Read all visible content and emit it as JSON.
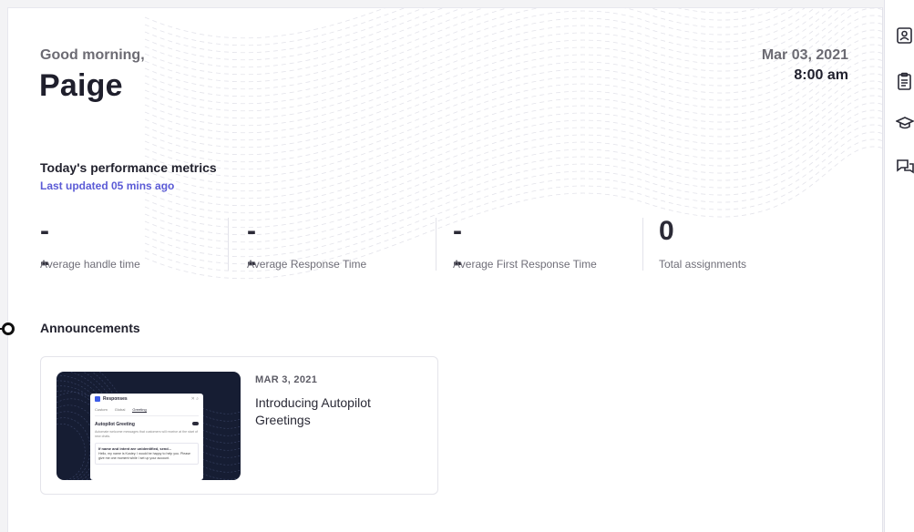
{
  "header": {
    "greeting": "Good morning,",
    "user_name": "Paige",
    "date": "Mar 03, 2021",
    "time": "8:00 am"
  },
  "performance": {
    "title": "Today's performance metrics",
    "last_updated": "Last updated 05 mins ago",
    "metrics": [
      {
        "value": "--",
        "label": "Average handle time"
      },
      {
        "value": "--",
        "label": "Average Response Time"
      },
      {
        "value": "--",
        "label": "Average First Response Time"
      },
      {
        "value": "0",
        "label": "Total assignments"
      }
    ]
  },
  "announcements": {
    "title": "Announcements",
    "items": [
      {
        "date": "MAR 3, 2021",
        "headline": "Introducing Autopilot Greetings",
        "thumbnail": {
          "panel_title": "Responses",
          "tabs": [
            "Custom",
            "Global",
            "Greeting"
          ],
          "section_title": "Autopilot Greeting",
          "description": "Automate welcome messages that customers will receive at the start of new chats.",
          "message_title": "If name and intent are unidentified, send...",
          "message_body": "Hello, my name is Kustey. I would be happy to help you. Please give me one moment while I set up your account."
        }
      }
    ]
  },
  "right_rail": {
    "icons": [
      "contact-card-icon",
      "clipboard-icon",
      "graduation-cap-icon",
      "chat-bubbles-icon"
    ]
  },
  "colors": {
    "accent": "#5b5bd6",
    "text_primary": "#1f1f2c",
    "text_secondary": "#6c6b73",
    "thumb_background": "#161d33"
  }
}
